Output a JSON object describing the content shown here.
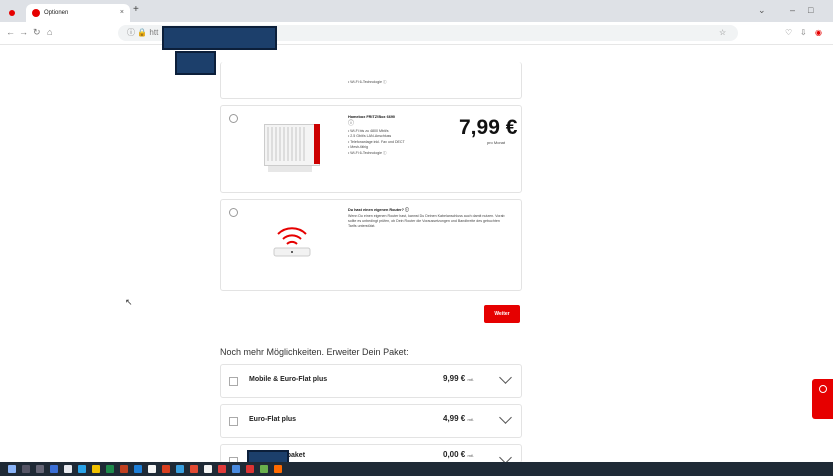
{
  "browser": {
    "tab_title": "Optionen",
    "tab_close": "×",
    "new_tab": "+",
    "url_prefix": "ⓘ 🔒 htt"
  },
  "options": [
    {
      "feature_top": "• Wi-Fi 6-Technologie ⓘ"
    },
    {
      "name": "Homebox FRITZ!Box 6690",
      "info": "ⓘ",
      "price": "7,99 €",
      "price_unit": "pro Monat",
      "features": [
        "• Wi-Fi 6-Technologie ⓘ"
      ]
    },
    {
      "name": "Du hast einen eigenen Router? ⓘ",
      "description": "Wenn Du einen eigenen Router hast, kannst Du Deinen Kabelanschluss auch damit nutzen. Vorab sollte es unbedingt prüfen, ob Dein Router die Voraussetzungen und Bandbreite des gebuchten Tarifs unterstützt."
    }
  ],
  "weiter_button": "Weiter",
  "more_heading": "Noch mehr Möglichkeiten. Erweiter Dein Paket:",
  "addons": [
    {
      "label": "Mobile & Euro-Flat plus",
      "price": "9,99 €",
      "unit": "mtl."
    },
    {
      "label": "Euro-Flat plus",
      "price": "4,99 €",
      "unit": "mtl."
    },
    {
      "label": "Sicherheitspaket",
      "price": "0,00 €",
      "unit": "mtl."
    }
  ],
  "colors": {
    "brand_red": "#e60000",
    "taskbar": "#1f2a36",
    "redaction": "#1c3f6b"
  }
}
